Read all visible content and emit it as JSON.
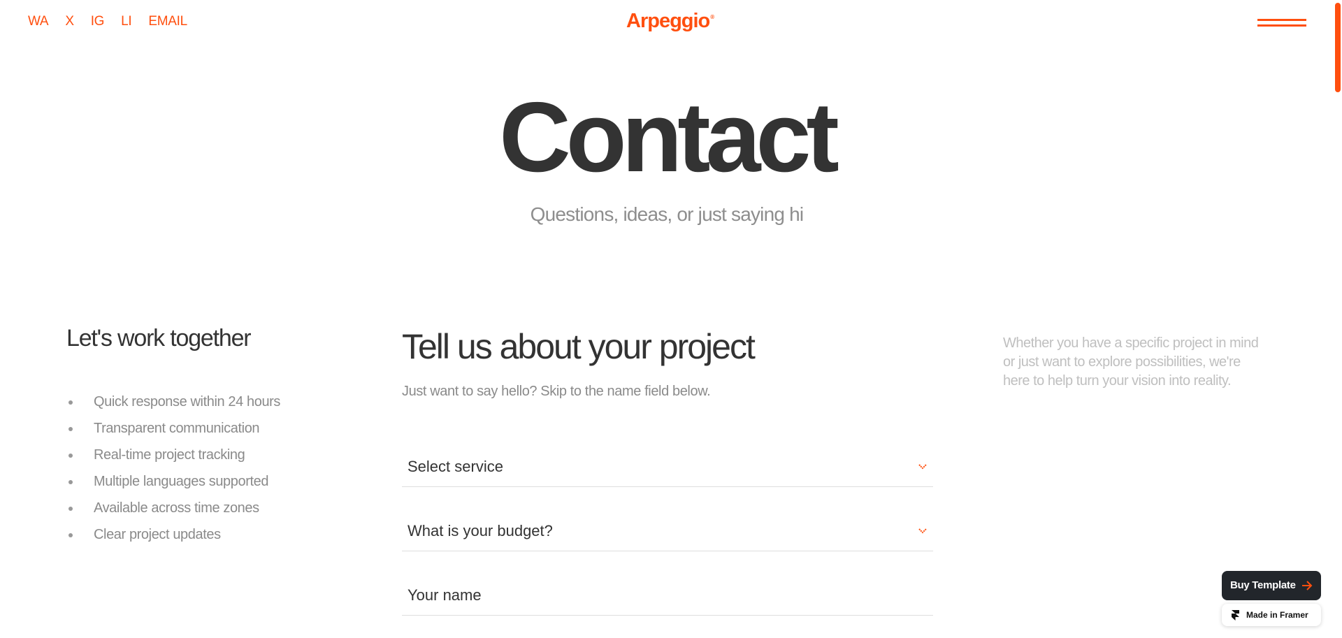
{
  "header": {
    "social_links": [
      "WA",
      "X",
      "IG",
      "LI",
      "EMAIL"
    ],
    "logo": "Arpeggio",
    "logo_mark": "®"
  },
  "hero": {
    "title": "Contact",
    "subtitle": "Questions, ideas, or just saying hi"
  },
  "left": {
    "heading": "Let's work together",
    "benefits": [
      "Quick response within 24 hours",
      "Transparent communication",
      "Real-time project tracking",
      "Multiple languages supported",
      "Available across time zones",
      "Clear project updates"
    ]
  },
  "form": {
    "heading": "Tell us about your project",
    "intro": "Just want to say hello? Skip to the name field below.",
    "service_label": "Select service",
    "budget_label": "What is your budget?",
    "name_label": "Your name"
  },
  "right": {
    "text": "Whether you have a specific project in mind or just want to explore possibilities, we're here to help turn your vision into reality."
  },
  "badges": {
    "buy_label": "Buy Template",
    "framer_label": "Made in Framer"
  },
  "colors": {
    "accent": "#ff4f0f",
    "text_dark": "#333333",
    "text_muted": "#8a8a8a"
  },
  "icons": [
    "hamburger-menu-icon",
    "chevron-down-icon",
    "arrow-right-icon",
    "framer-logo-icon"
  ]
}
